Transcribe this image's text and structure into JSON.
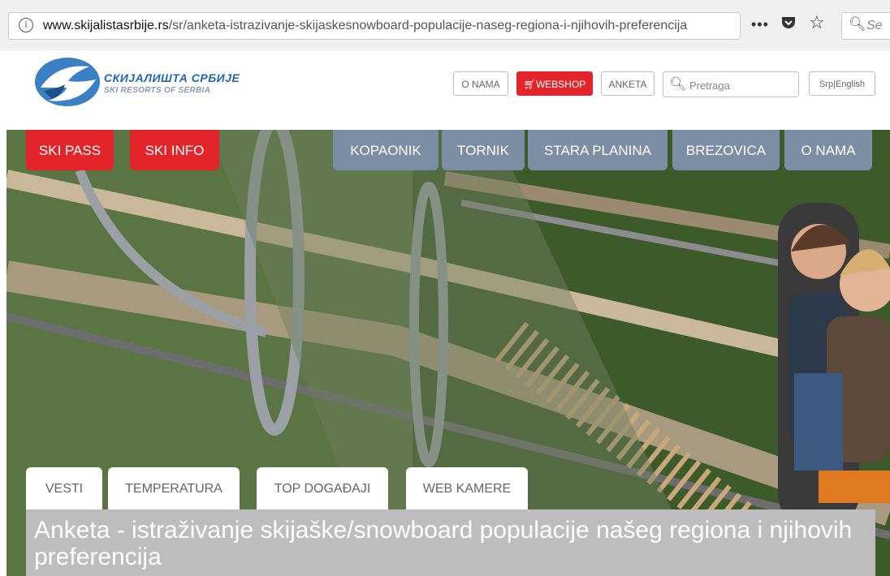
{
  "browser": {
    "url_domain": "www.skijalistasrbije.rs",
    "url_path": "/sr/anketa-istrazivanje-skijaskesnowboard-populacije-naseg-regiona-i-njihovih-preferencija",
    "more_glyph": "•••",
    "search_placeholder": "Se"
  },
  "header": {
    "logo_line1": "СКИЈАЛИШТА СРБИЈЕ",
    "logo_line2": "SKI RESORTS OF SERBIA",
    "buttons": {
      "o_nama": "O NAMA",
      "webshop": "WEBSHOP",
      "anketa": "ANKETA",
      "language": "Srp|English"
    },
    "search_placeholder": "Pretraga",
    "webshop_color": "#e2252b"
  },
  "nav": {
    "red_tabs": [
      "SKI PASS",
      "SKI INFO"
    ],
    "gray_tabs": [
      "KOPAONIK",
      "TORNIK",
      "STARA PLANINA",
      "BREZOVICA",
      "O NAMA"
    ],
    "red_color": "#e2252b",
    "gray_color": "#7b8ea3"
  },
  "sub_tabs": [
    "VESTI",
    "TEMPERATURA",
    "TOP DOGAĐAJI",
    "WEB KAMERE"
  ],
  "page_title": "Anketa - istraživanje skijaške/snowboard populacije našeg regiona i njihovih preferencija",
  "icons": [
    "info-icon",
    "more-icon",
    "pocket-icon",
    "star-icon",
    "search-icon",
    "cart-icon",
    "logo-icon"
  ]
}
